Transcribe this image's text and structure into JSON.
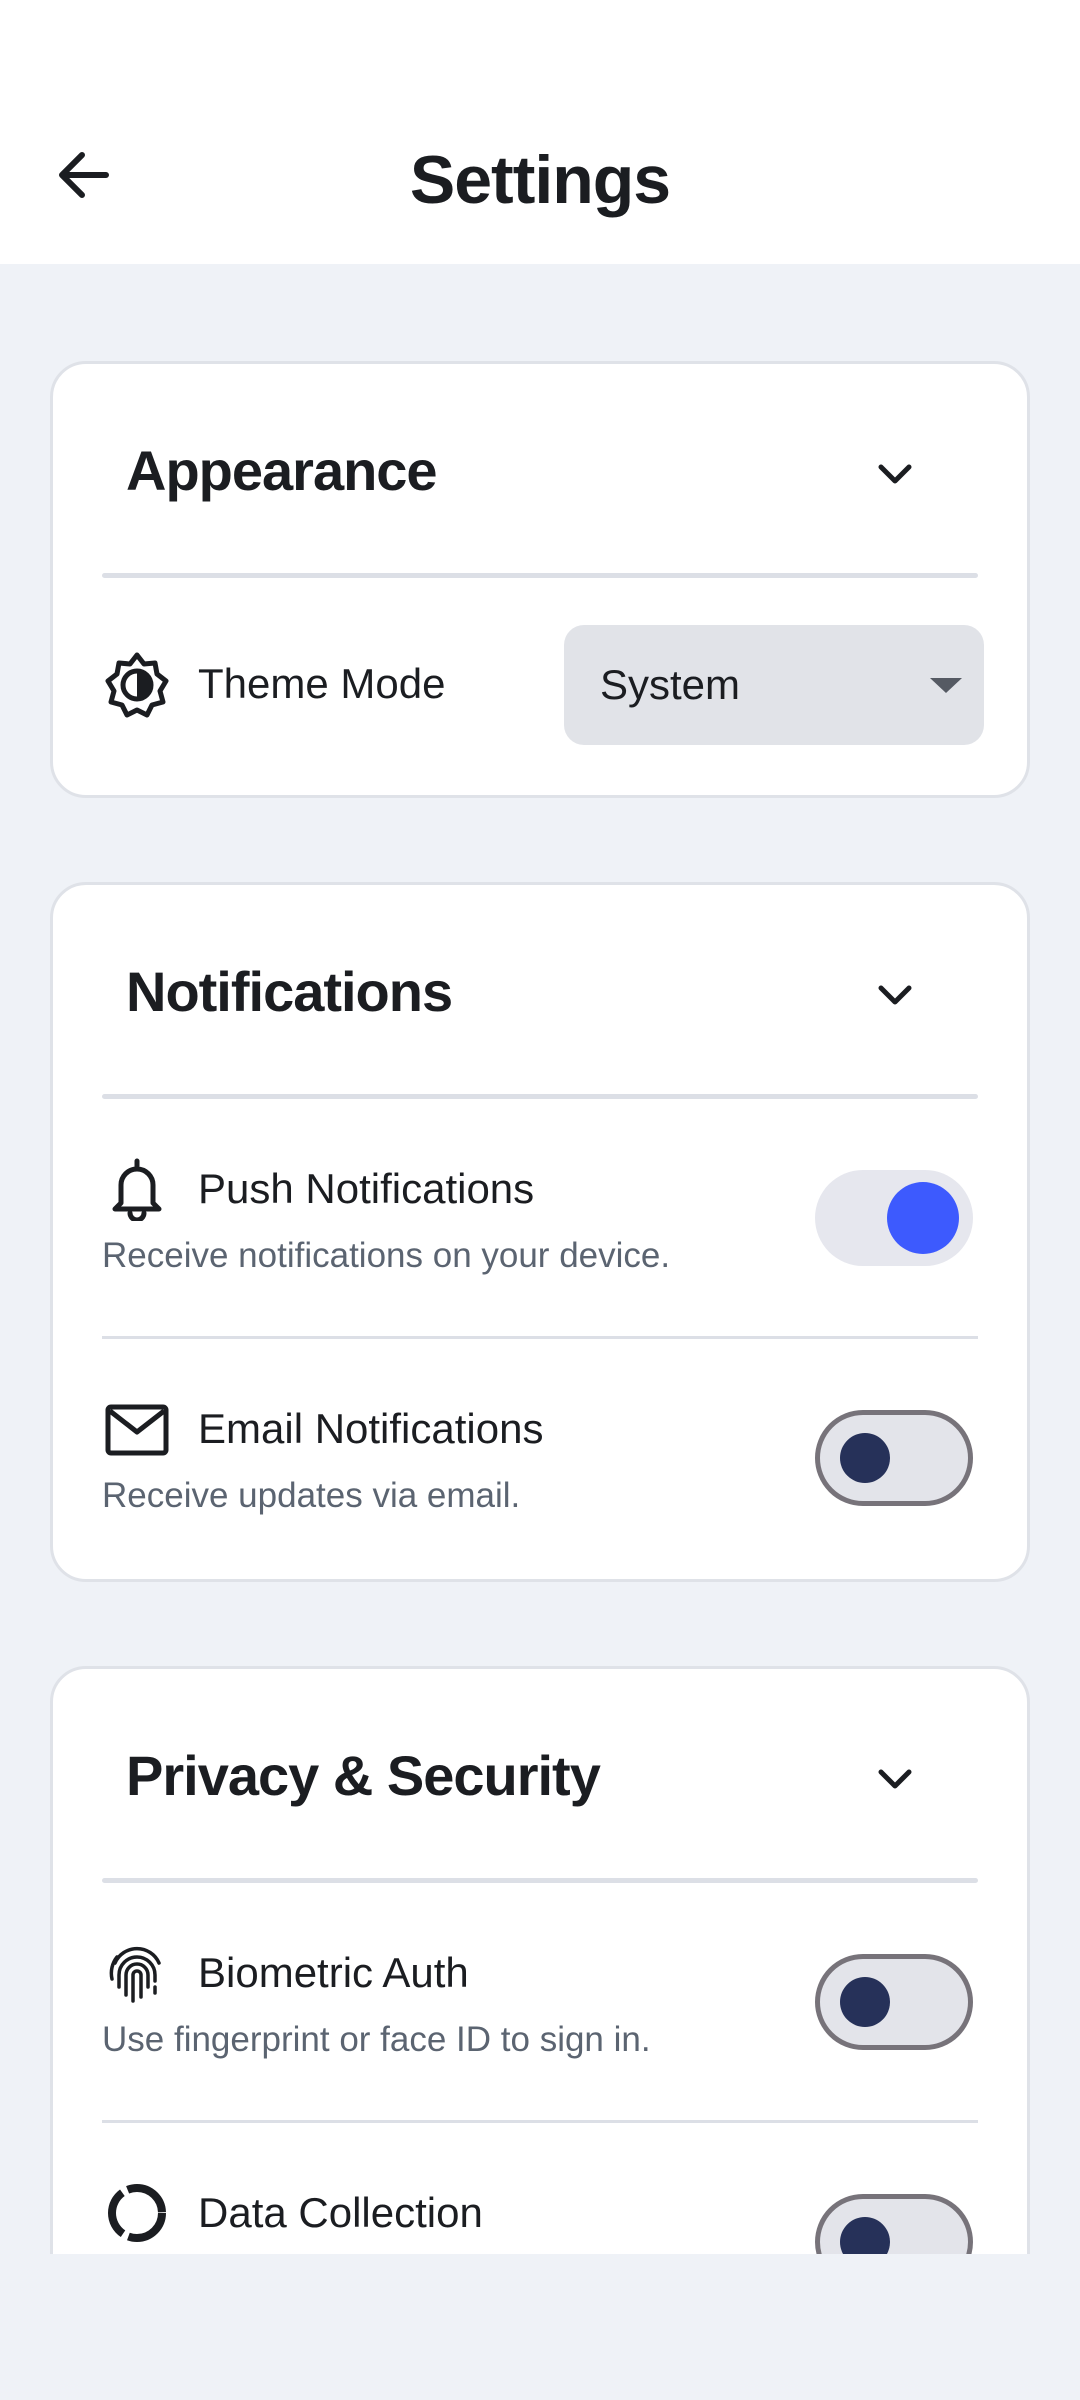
{
  "header": {
    "title": "Settings",
    "back_icon": "arrow-left-icon"
  },
  "sections": [
    {
      "title": "Appearance",
      "items": [
        {
          "icon": "theme-contrast-icon",
          "label": "Theme Mode",
          "select_value": "System"
        }
      ]
    },
    {
      "title": "Notifications",
      "items": [
        {
          "icon": "bell-icon",
          "label": "Push Notifications",
          "description": "Receive notifications on your device.",
          "enabled": true
        },
        {
          "icon": "mail-icon",
          "label": "Email Notifications",
          "description": "Receive updates via email.",
          "enabled": false
        }
      ]
    },
    {
      "title": "Privacy & Security",
      "items": [
        {
          "icon": "fingerprint-icon",
          "label": "Biometric Auth",
          "description": "Use fingerprint or face ID to sign in.",
          "enabled": false
        },
        {
          "icon": "data-ring-icon",
          "label": "Data Collection",
          "enabled": false
        }
      ]
    }
  ],
  "colors": {
    "accent": "#3d5afe",
    "knob_off": "#263159",
    "background": "#eff2f7",
    "card": "#ffffff"
  }
}
